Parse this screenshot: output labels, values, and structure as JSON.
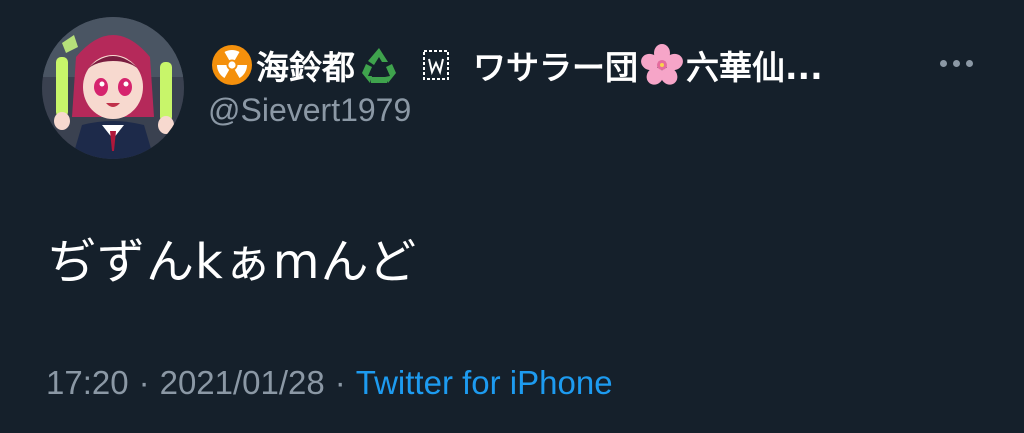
{
  "tweet": {
    "display_name": {
      "part1": "海鈴都",
      "part2": "ワサラー団",
      "part3": "六華仙..."
    },
    "username": "@Sievert1979",
    "text": "ぢずんkぁmんど",
    "time": "17:20",
    "date": "2021/01/28",
    "separator": "·",
    "source": "Twitter for iPhone"
  },
  "icons": {
    "radioactive": "radioactive-icon",
    "recycle": "recycle-icon",
    "w_box": "w-box-icon",
    "cherry_blossom": "cherry-blossom-icon",
    "more": "more-icon"
  },
  "colors": {
    "background": "#15202b",
    "text": "#ffffff",
    "secondary_text": "#8b98a5",
    "link": "#1d9bf0"
  }
}
